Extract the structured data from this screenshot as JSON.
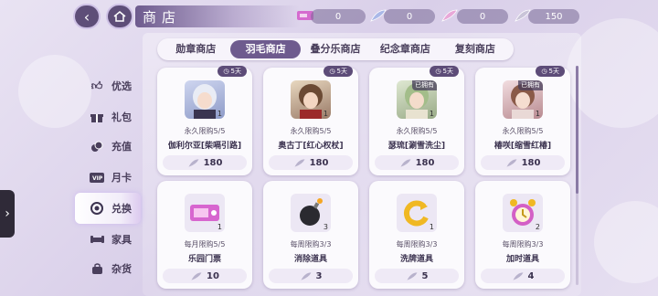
{
  "header": {
    "title": "商店",
    "back_icon": "back-arrow-icon",
    "home_icon": "home-icon"
  },
  "resources": [
    {
      "icon": "ticket-icon",
      "value": "0"
    },
    {
      "icon": "blue-feather-icon",
      "value": "0"
    },
    {
      "icon": "pink-feather-icon",
      "value": "0"
    },
    {
      "icon": "silver-feather-icon",
      "value": "150"
    }
  ],
  "tabs": [
    {
      "label": "勋章商店",
      "active": false
    },
    {
      "label": "羽毛商店",
      "active": true
    },
    {
      "label": "叠分乐商店",
      "active": false
    },
    {
      "label": "纪念章商店",
      "active": false
    },
    {
      "label": "复刻商店",
      "active": false
    }
  ],
  "nav": [
    {
      "label": "优选",
      "icon": "thumbs-up-icon",
      "active": false
    },
    {
      "label": "礼包",
      "icon": "gift-icon",
      "active": false
    },
    {
      "label": "充值",
      "icon": "coins-icon",
      "active": false
    },
    {
      "label": "月卡",
      "icon": "vip-card-icon",
      "active": false
    },
    {
      "label": "兑换",
      "icon": "exchange-icon",
      "active": true
    },
    {
      "label": "家具",
      "icon": "furniture-icon",
      "active": false
    },
    {
      "label": "杂货",
      "icon": "bag-icon",
      "active": false
    }
  ],
  "items": [
    {
      "badge": "5天",
      "limit": "永久限购5/5",
      "name": "伽利尔亚[柴嗝引路]",
      "price": "180",
      "qty": "1",
      "owned": "",
      "thumb": "silver-hair-portrait"
    },
    {
      "badge": "5天",
      "limit": "永久限购5/5",
      "name": "奥古丁[红心权杖]",
      "price": "180",
      "qty": "1",
      "owned": "",
      "thumb": "brown-hair-portrait"
    },
    {
      "badge": "5天",
      "limit": "永久限购5/5",
      "name": "瑟琉[涮雪洗尘]",
      "price": "180",
      "qty": "1",
      "owned": "已拥有",
      "thumb": "green-hair-portrait"
    },
    {
      "badge": "5天",
      "limit": "永久限购5/5",
      "name": "椿咲[缩雪红椿]",
      "price": "180",
      "qty": "1",
      "owned": "已拥有",
      "thumb": "pink-hair-portrait"
    },
    {
      "badge": "",
      "limit": "每月限购5/5",
      "name": "乐园门票",
      "price": "10",
      "qty": "1",
      "owned": "",
      "thumb": "ticket-item-icon"
    },
    {
      "badge": "",
      "limit": "每周限购3/3",
      "name": "消除道具",
      "price": "3",
      "qty": "3",
      "owned": "",
      "thumb": "bomb-item-icon"
    },
    {
      "badge": "",
      "limit": "每周限购3/3",
      "name": "洗牌道具",
      "price": "5",
      "qty": "1",
      "owned": "",
      "thumb": "refresh-item-icon"
    },
    {
      "badge": "",
      "limit": "每周限购3/3",
      "name": "加时道具",
      "price": "4",
      "qty": "2",
      "owned": "",
      "thumb": "alarm-clock-item-icon"
    }
  ],
  "colors": {
    "accent": "#6e5b8e",
    "badge": "#5d4c78",
    "card": "#fbfafd"
  }
}
